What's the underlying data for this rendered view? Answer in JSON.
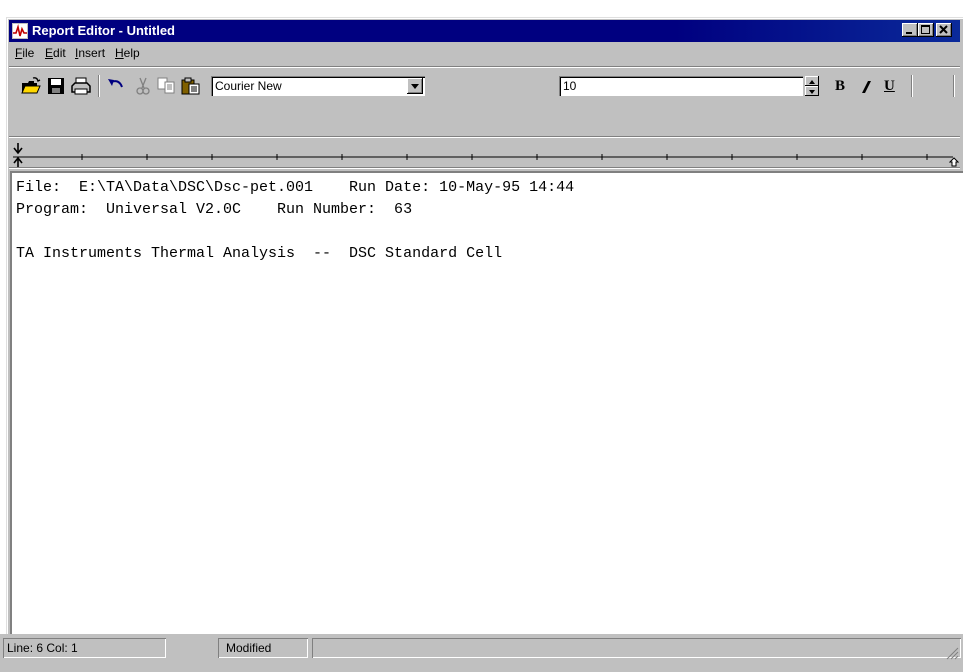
{
  "window": {
    "title": "Report Editor - Untitled"
  },
  "menu": [
    "File",
    "Edit",
    "Insert",
    "Help"
  ],
  "menu_mnemonic": [
    "F",
    "E",
    "I",
    "H"
  ],
  "toolbar": {
    "font_name": "Courier New",
    "font_size": "10",
    "bold_label": "B",
    "italic_label": "I",
    "underline_label": "U",
    "icons": [
      "open-icon",
      "save-icon",
      "print-icon",
      "undo-icon",
      "cut-icon",
      "copy-icon",
      "paste-icon"
    ]
  },
  "document": {
    "lines": [
      "File:  E:\\TA\\Data\\DSC\\Dsc-pet.001    Run Date: 10-May-95 14:44",
      "Program:  Universal V2.0C    Run Number:  63",
      "",
      "TA Instruments Thermal Analysis  --  DSC Standard Cell"
    ]
  },
  "status": {
    "position": "Line:  6  Col:  1",
    "state": "Modified"
  },
  "colors": {
    "titlebar": "#000080",
    "face": "#c0c0c0"
  }
}
